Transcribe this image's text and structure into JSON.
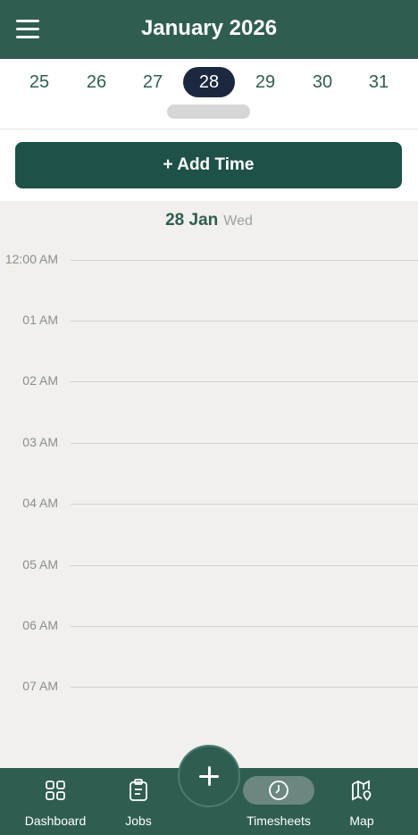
{
  "header": {
    "title": "January 2026",
    "menu_icon": "hamburger-menu-icon"
  },
  "date_strip": {
    "days": [
      "25",
      "26",
      "27",
      "28",
      "29",
      "30",
      "31"
    ],
    "selected": "28"
  },
  "add_button": {
    "label": "+ Add Time"
  },
  "day_header": {
    "date": "28 Jan",
    "weekday": "Wed"
  },
  "timeline": {
    "hours": [
      "12:00 AM",
      "01 AM",
      "02 AM",
      "03 AM",
      "04 AM",
      "05 AM",
      "06 AM",
      "07 AM"
    ]
  },
  "bottom_nav": {
    "items": [
      {
        "label": "Dashboard",
        "icon": "grid-icon"
      },
      {
        "label": "Jobs",
        "icon": "clipboard-icon"
      },
      {
        "label": "Timesheets",
        "icon": "clock-icon",
        "active": true
      },
      {
        "label": "Map",
        "icon": "map-pin-icon"
      }
    ],
    "fab_icon": "plus-icon"
  },
  "colors": {
    "primary": "#2f5d52",
    "selected_day": "#1c2840",
    "background": "#f2f0ec"
  }
}
